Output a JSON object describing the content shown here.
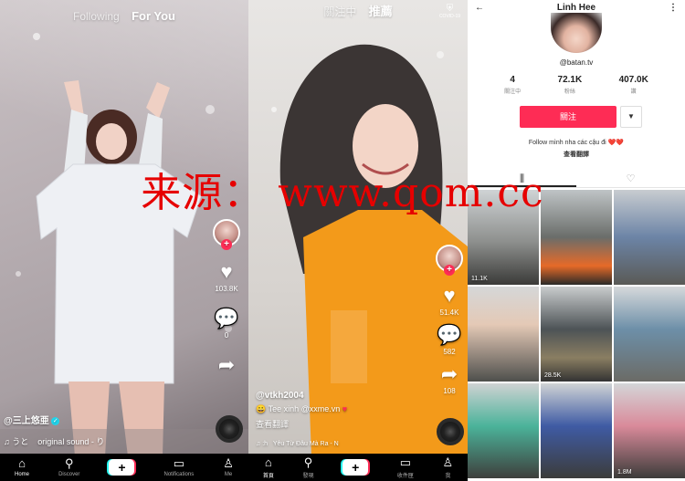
{
  "panel1": {
    "tabs": {
      "following": "Following",
      "for_you": "For You"
    },
    "likes": "103.8K",
    "comments": "0",
    "username": "@三上悠亜",
    "caption": "うと",
    "sound": "original sound - り"
  },
  "panel2": {
    "tabs": {
      "following": "關注中",
      "recommended": "推薦"
    },
    "covid_label": "COVID-19",
    "likes": "51.4K",
    "comments": "582",
    "shares": "108",
    "username": "@vtkh2004",
    "caption": "Tee xinh @xxme.vn",
    "translate": "查看翻譯",
    "sound": "Yêu Từ Đâu Mà Ra - N"
  },
  "profile": {
    "name": "Linh Hee",
    "handle": "@batan.tv",
    "stats": [
      {
        "num": "4",
        "label": "關注中"
      },
      {
        "num": "72.1K",
        "label": "粉絲"
      },
      {
        "num": "407.0K",
        "label": "讚"
      }
    ],
    "follow_label": "關注",
    "bio": "Follow mình nha các cậu đi ❤️❤️",
    "bio_translate": "查看翻譯",
    "views": [
      "11.1K",
      "",
      "",
      "",
      "28.5K",
      "",
      "",
      "",
      "1.8M"
    ]
  },
  "nav_en": [
    {
      "icon": "home-icon",
      "label": "Home"
    },
    {
      "icon": "discover-icon",
      "label": "Discover"
    },
    {
      "icon": "create-icon",
      "label": ""
    },
    {
      "icon": "inbox-icon",
      "label": "Notifications"
    },
    {
      "icon": "profile-icon",
      "label": "Me"
    }
  ],
  "nav_zh": [
    {
      "icon": "home-icon",
      "label": "首頁"
    },
    {
      "icon": "discover-icon",
      "label": "發現"
    },
    {
      "icon": "create-icon",
      "label": ""
    },
    {
      "icon": "inbox-icon",
      "label": "收件匣"
    },
    {
      "icon": "profile-icon",
      "label": "我"
    }
  ],
  "watermark": "来源：  www.qom.cc",
  "colors": {
    "accent": "#fe2c55",
    "cyan": "#25f4ee",
    "orange": "#f39a1a"
  }
}
